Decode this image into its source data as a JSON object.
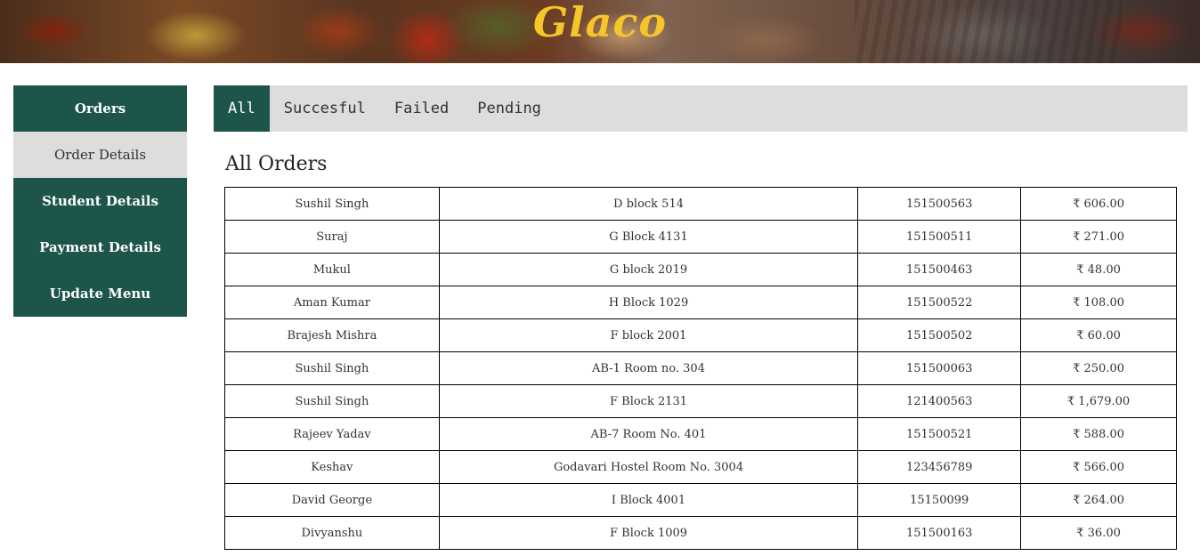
{
  "header": {
    "logo": "Glaco"
  },
  "sidebar": {
    "items": [
      {
        "label": "Orders"
      },
      {
        "label": "Order Details"
      },
      {
        "label": "Student Details"
      },
      {
        "label": "Payment Details"
      },
      {
        "label": "Update Menu"
      }
    ],
    "active_index": 1
  },
  "tabs": {
    "items": [
      {
        "label": "All"
      },
      {
        "label": "Succesful"
      },
      {
        "label": "Failed"
      },
      {
        "label": "Pending"
      }
    ],
    "active_index": 0
  },
  "main": {
    "title": "All Orders",
    "rows": [
      {
        "name": "Sushil Singh",
        "address": "D block 514",
        "id": "151500563",
        "amount": "₹ 606.00"
      },
      {
        "name": "Suraj",
        "address": "G Block 4131",
        "id": "151500511",
        "amount": "₹ 271.00"
      },
      {
        "name": "Mukul",
        "address": "G block 2019",
        "id": "151500463",
        "amount": "₹ 48.00"
      },
      {
        "name": "Aman Kumar",
        "address": "H Block 1029",
        "id": "151500522",
        "amount": "₹ 108.00"
      },
      {
        "name": "Brajesh Mishra",
        "address": "F block 2001",
        "id": "151500502",
        "amount": "₹ 60.00"
      },
      {
        "name": "Sushil Singh",
        "address": "AB-1 Room no. 304",
        "id": "151500063",
        "amount": "₹ 250.00"
      },
      {
        "name": "Sushil Singh",
        "address": "F Block 2131",
        "id": "121400563",
        "amount": "₹ 1,679.00"
      },
      {
        "name": "Rajeev Yadav",
        "address": "AB-7 Room No. 401",
        "id": "151500521",
        "amount": "₹ 588.00"
      },
      {
        "name": "Keshav",
        "address": "Godavari Hostel Room No. 3004",
        "id": "123456789",
        "amount": "₹ 566.00"
      },
      {
        "name": "David George",
        "address": "I Block 4001",
        "id": "15150099",
        "amount": "₹ 264.00"
      },
      {
        "name": "Divyanshu",
        "address": "F Block 1009",
        "id": "151500163",
        "amount": "₹ 36.00"
      }
    ]
  },
  "colors": {
    "primary": "#1d554b",
    "tab_bar": "#dddddd",
    "logo": "#f6c42b"
  }
}
